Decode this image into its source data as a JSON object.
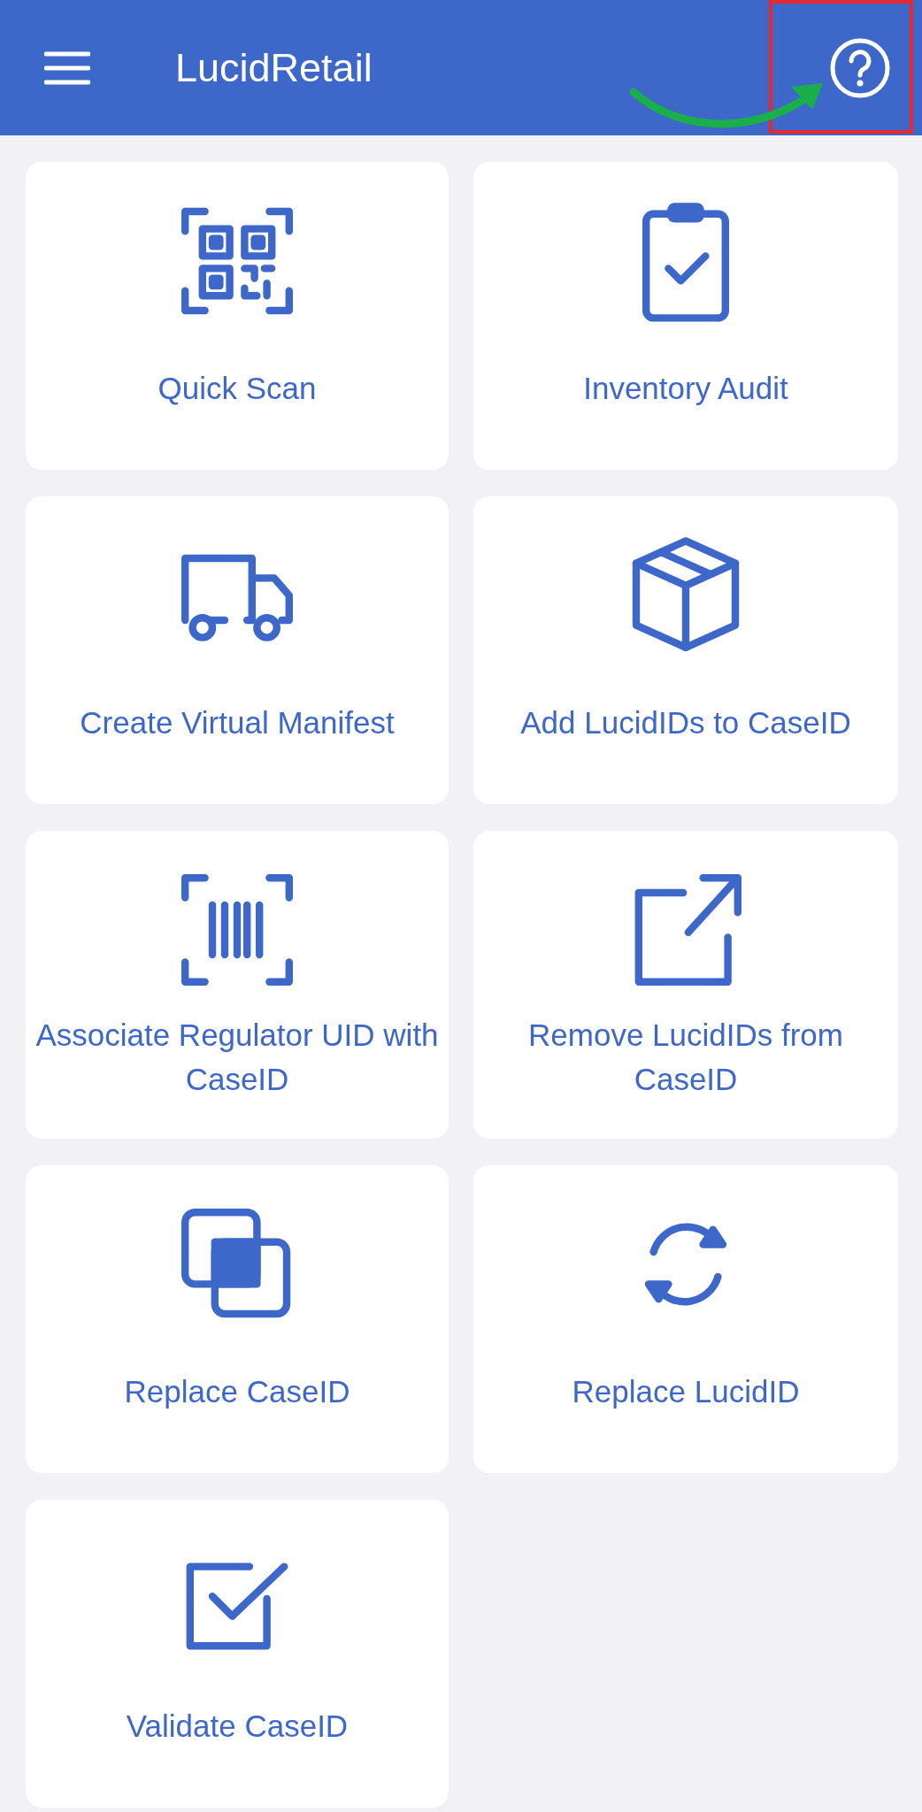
{
  "app_bar": {
    "title": "LucidRetail"
  },
  "tiles": [
    {
      "label": "Quick Scan"
    },
    {
      "label": "Inventory Audit"
    },
    {
      "label": "Create Virtual Manifest"
    },
    {
      "label": "Add LucidIDs to CaseID"
    },
    {
      "label": "Associate Regulator UID with CaseID"
    },
    {
      "label": "Remove LucidIDs from CaseID"
    },
    {
      "label": "Replace CaseID"
    },
    {
      "label": "Replace LucidID"
    },
    {
      "label": "Validate CaseID"
    }
  ]
}
